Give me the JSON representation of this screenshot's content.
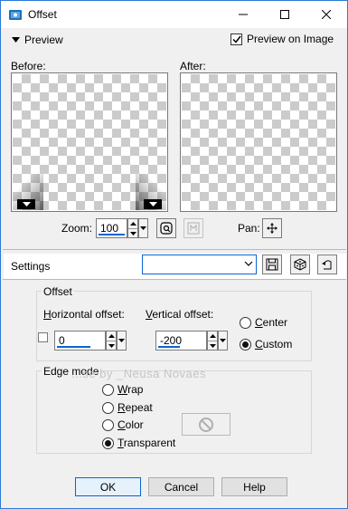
{
  "window": {
    "title": "Offset",
    "minimize": "minimize",
    "maximize": "maximize",
    "close": "close"
  },
  "preview_toggle": {
    "label": "Preview"
  },
  "preview_on_image": {
    "label": "Preview on Image",
    "checked": true
  },
  "before": {
    "label": "Before:"
  },
  "after": {
    "label": "After:"
  },
  "zoom": {
    "label": "Zoom:",
    "value": "100"
  },
  "pan": {
    "label": "Pan:"
  },
  "settings": {
    "label": "Settings",
    "preset_value": ""
  },
  "offset": {
    "group_title": "Offset",
    "horizontal_label": "Horizontal offset:",
    "horizontal_value": "0",
    "vertical_label": "Vertical offset:",
    "vertical_value": "-200",
    "center_label": "Center",
    "custom_label": "Custom",
    "selected": "Custom"
  },
  "edge_mode": {
    "group_title": "Edge mode",
    "options": [
      "Wrap",
      "Repeat",
      "Color",
      "Transparent"
    ],
    "selected": "Transparent"
  },
  "watermark": "...se by _Neusa Novaes",
  "buttons": {
    "ok": "OK",
    "cancel": "Cancel",
    "help": "Help"
  },
  "colors": {
    "accent": "#0a64d2",
    "title_icon": "#1b6fb7",
    "checker": "#cbcbcb"
  }
}
